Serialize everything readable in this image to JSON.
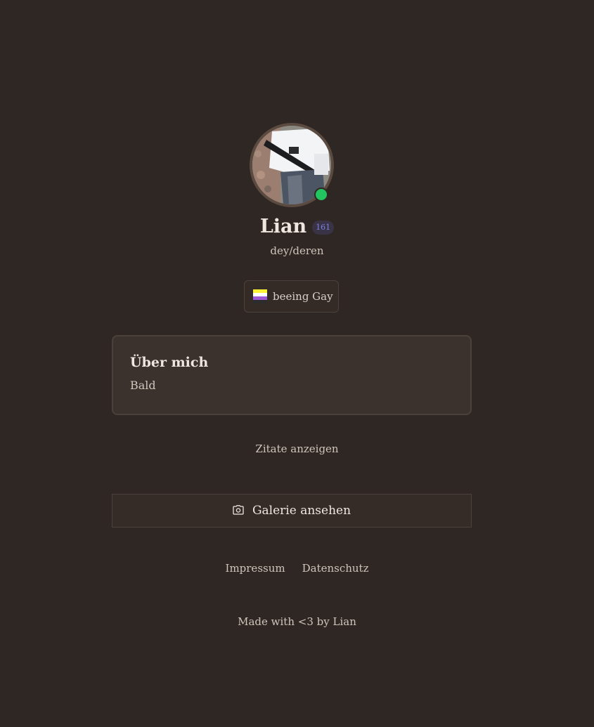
{
  "profile": {
    "name": "Lian",
    "badge": "161",
    "pronouns": "dey/deren",
    "status": "online",
    "status_color": "#22c55e"
  },
  "tag": {
    "label": "beeing Gay",
    "flag_icon": "nonbinary-flag-icon",
    "flag_colors": [
      "#fcf434",
      "#ffffff",
      "#9c59d1",
      "#2c2c2c"
    ]
  },
  "about": {
    "title": "Über mich",
    "text": "Bald"
  },
  "quotes": {
    "label": "Zitate anzeigen"
  },
  "gallery": {
    "icon": "camera-icon",
    "label": "Galerie ansehen"
  },
  "footer": {
    "impressum": "Impressum",
    "datenschutz": "Datenschutz",
    "made_with": "Made with <3 by Lian"
  },
  "colors": {
    "background": "#2f2723",
    "card": "#3b322e",
    "badge_text": "#7b83e8"
  }
}
